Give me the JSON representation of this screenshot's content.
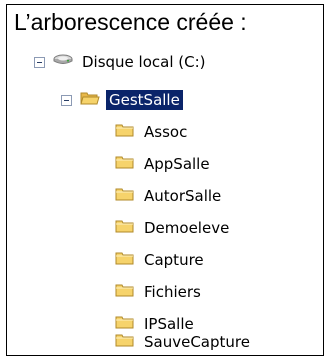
{
  "caption": "L’arborescence créée :",
  "tree": {
    "root": {
      "label": "Disque local (C:)",
      "icon": "hard-drive-icon"
    },
    "selected_folder": {
      "label": "GestSalle",
      "icon": "open-folder-icon"
    },
    "children": [
      {
        "label": "Assoc",
        "icon": "folder-icon"
      },
      {
        "label": "AppSalle",
        "icon": "folder-icon"
      },
      {
        "label": "AutorSalle",
        "icon": "folder-icon"
      },
      {
        "label": "Demoeleve",
        "icon": "folder-icon"
      },
      {
        "label": "Capture",
        "icon": "folder-icon"
      },
      {
        "label": "Fichiers",
        "icon": "folder-icon"
      },
      {
        "label": "IPSalle",
        "icon": "folder-icon"
      },
      {
        "label": "SauveCapture",
        "icon": "folder-icon"
      }
    ]
  },
  "colors": {
    "selection_bg": "#0a246a",
    "selection_text": "#ffffff",
    "folder_fill": "#f6d36b",
    "folder_edge": "#b08a2a"
  }
}
